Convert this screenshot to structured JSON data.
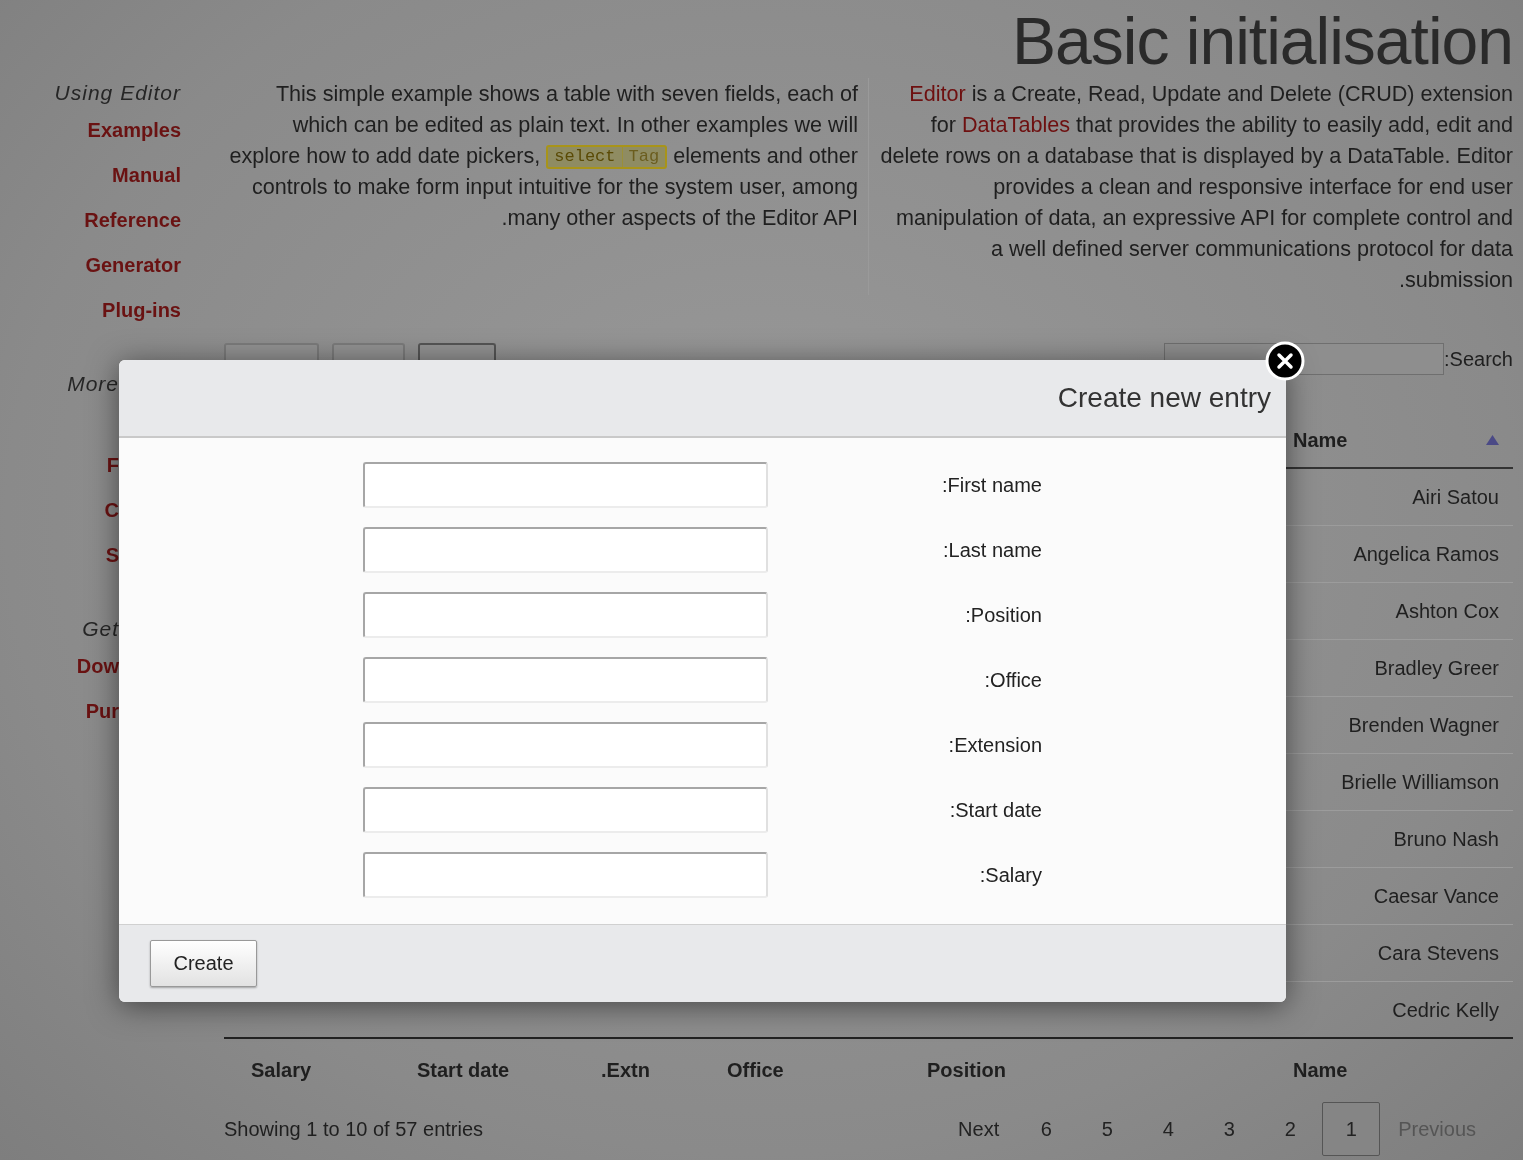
{
  "page_title": "Basic initialisation",
  "sidebar": [
    {
      "heading": "Using Editor",
      "clipped": false,
      "items": [
        "Examples",
        "Manual",
        "Reference",
        "Generator",
        "Plug-ins"
      ]
    },
    {
      "heading": "More",
      "clipped": true,
      "items": [
        "F",
        "C",
        "S"
      ]
    },
    {
      "heading": "Get",
      "clipped": true,
      "items": [
        "Dow",
        "Pur"
      ]
    }
  ],
  "intro_left": {
    "before": "This simple example shows a table with seven fields, each of which can be edited as plain text. In other examples we will explore how to add date pickers,",
    "code": [
      "select",
      "Tag"
    ],
    "after": "elements and other controls to make form input intuitive for the system user, among .many other aspects of the Editor API"
  },
  "intro_right": [
    {
      "text": "Editor",
      "link": true
    },
    {
      "text": " is a Create, Read, Update and Delete (CRUD) extension for ",
      "link": false
    },
    {
      "text": "DataTables",
      "link": true
    },
    {
      "text": " that provides the ability to easily add, edit and delete rows on a database that is displayed by a DataTable. Editor provides a clean and responsive interface for end user manipulation of data, an expressive API for complete control and a well defined server communications protocol for data .submission",
      "link": false
    }
  ],
  "search": {
    "label": ":Search"
  },
  "table": {
    "header": "Name",
    "rows": [
      "Airi Satou",
      "Angelica Ramos",
      "Ashton Cox",
      "Bradley Greer",
      "Brenden Wagner",
      "Brielle Williamson",
      "Bruno Nash",
      "Caesar Vance",
      "Cara Stevens",
      "Cedric Kelly"
    ],
    "footer": [
      "Salary",
      "Start date",
      ".Extn",
      "Office",
      "Position",
      "Name"
    ]
  },
  "info": "Showing 1 to 10 of 57 entries",
  "pagination": [
    {
      "label": "Next",
      "selected": false,
      "disabled": false
    },
    {
      "label": "6",
      "selected": false,
      "disabled": false
    },
    {
      "label": "5",
      "selected": false,
      "disabled": false
    },
    {
      "label": "4",
      "selected": false,
      "disabled": false
    },
    {
      "label": "3",
      "selected": false,
      "disabled": false
    },
    {
      "label": "2",
      "selected": false,
      "disabled": false
    },
    {
      "label": "1",
      "selected": true,
      "disabled": false
    },
    {
      "label": "Previous",
      "selected": false,
      "disabled": true
    }
  ],
  "modal": {
    "title": "Create new entry",
    "fields": [
      ":First name",
      ":Last name",
      ":Position",
      ":Office",
      ":Extension",
      ":Start date",
      ":Salary"
    ],
    "button": "Create"
  }
}
